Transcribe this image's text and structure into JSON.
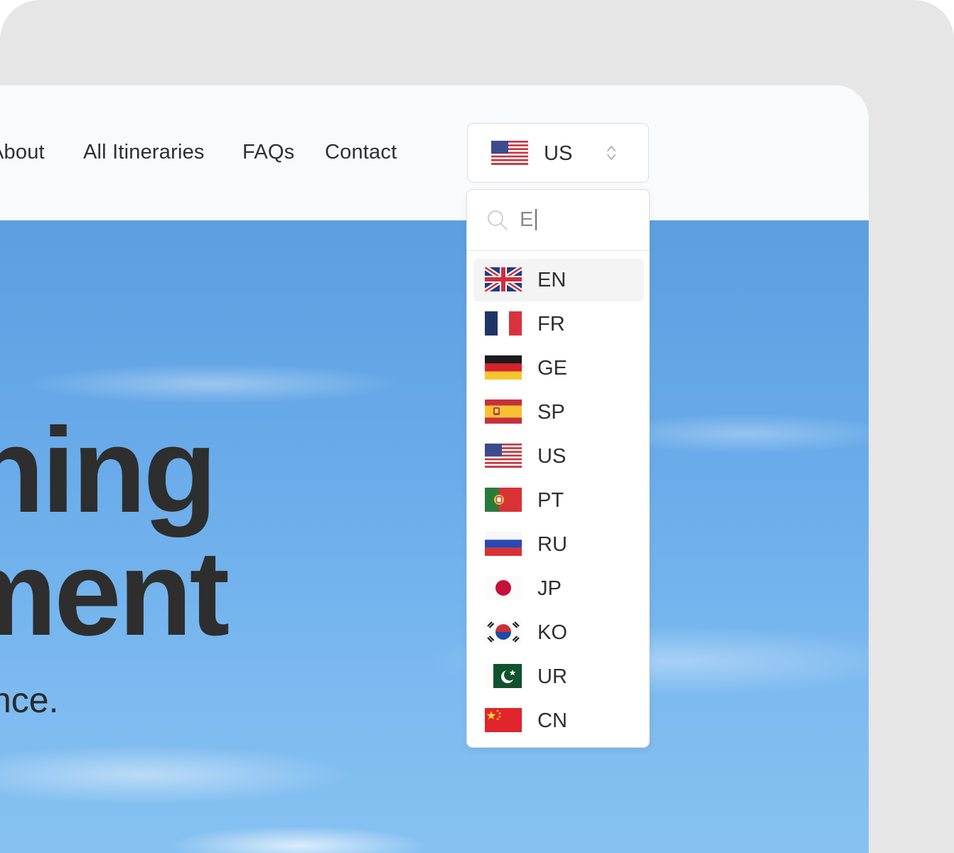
{
  "nav": {
    "links": [
      {
        "label": "About"
      },
      {
        "label": "All Itineraries"
      },
      {
        "label": "FAQs"
      },
      {
        "label": "Contact"
      }
    ]
  },
  "hero": {
    "line1": "something",
    "line2": "moment",
    "sub": "experience."
  },
  "locale_selector": {
    "selected_code": "US",
    "selected_flag": "us-flag-icon"
  },
  "dropdown": {
    "search_value": "E",
    "options": [
      {
        "code": "EN",
        "flag": "uk-flag-icon",
        "highlighted": true
      },
      {
        "code": "FR",
        "flag": "france-flag-icon"
      },
      {
        "code": "GE",
        "flag": "germany-flag-icon"
      },
      {
        "code": "SP",
        "flag": "spain-flag-icon"
      },
      {
        "code": "US",
        "flag": "us-flag-icon"
      },
      {
        "code": "PT",
        "flag": "portugal-flag-icon"
      },
      {
        "code": "RU",
        "flag": "russia-flag-icon"
      },
      {
        "code": "JP",
        "flag": "japan-flag-icon"
      },
      {
        "code": "KO",
        "flag": "korea-flag-icon"
      },
      {
        "code": "UR",
        "flag": "pakistan-flag-icon"
      },
      {
        "code": "CN",
        "flag": "china-flag-icon"
      }
    ]
  }
}
